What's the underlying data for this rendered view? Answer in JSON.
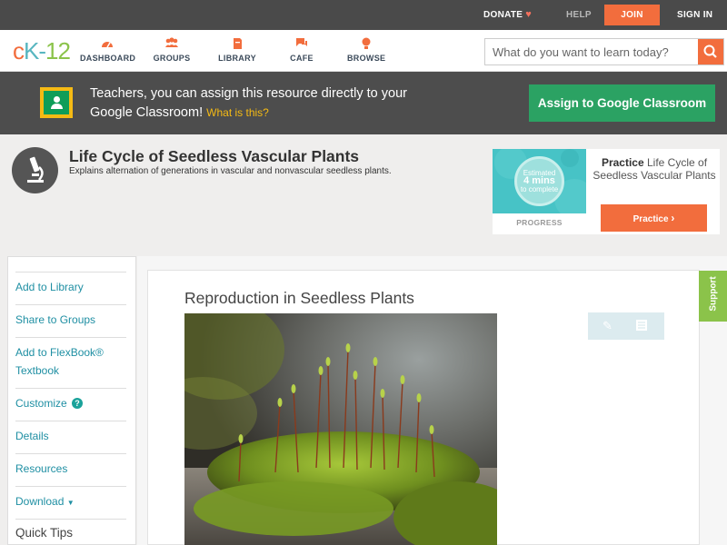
{
  "topbar": {
    "donate": "DONATE",
    "help": "HELP",
    "join": "JOIN",
    "signin": "SIGN IN"
  },
  "nav": {
    "logo": {
      "c": "c",
      "k": "K",
      "dash": "-",
      "num": "12"
    },
    "items": [
      {
        "label": "DASHBOARD",
        "icon": "dashboard-icon"
      },
      {
        "label": "GROUPS",
        "icon": "groups-icon"
      },
      {
        "label": "LIBRARY",
        "icon": "library-icon"
      },
      {
        "label": "CAFE",
        "icon": "cafe-icon"
      },
      {
        "label": "BROWSE",
        "icon": "browse-icon"
      }
    ],
    "search_placeholder": "What do you want to learn today?"
  },
  "classroom": {
    "text": "Teachers, you can assign this resource directly to your Google Classroom!",
    "link": "What is this?",
    "button": "Assign to Google Classroom"
  },
  "header": {
    "title": "Life Cycle of Seedless Vascular Plants",
    "subtitle": "Explains alternation of generations in vascular and nonvascular seedless plants."
  },
  "practice": {
    "estimated": "Estimated",
    "mins": "4 mins",
    "complete": "to complete",
    "progress": "PROGRESS",
    "practice_word": "Practice",
    "title": "Life Cycle of Seedless Vascular Plants",
    "button": "Practice"
  },
  "sidebar": {
    "items": [
      "Add to Library",
      "Share to Groups",
      "Add to FlexBook® Textbook",
      "Customize",
      "Details",
      "Resources",
      "Download"
    ],
    "help_badge": "?",
    "download_arrow": "▼",
    "quick_tips": "Quick Tips"
  },
  "content": {
    "heading": "Reproduction in Seedless Plants"
  },
  "support": "Support",
  "colors": {
    "accent": "#f26d3d",
    "teal": "#1f8fa3",
    "green": "#2ba263",
    "support": "#8bc34a"
  }
}
